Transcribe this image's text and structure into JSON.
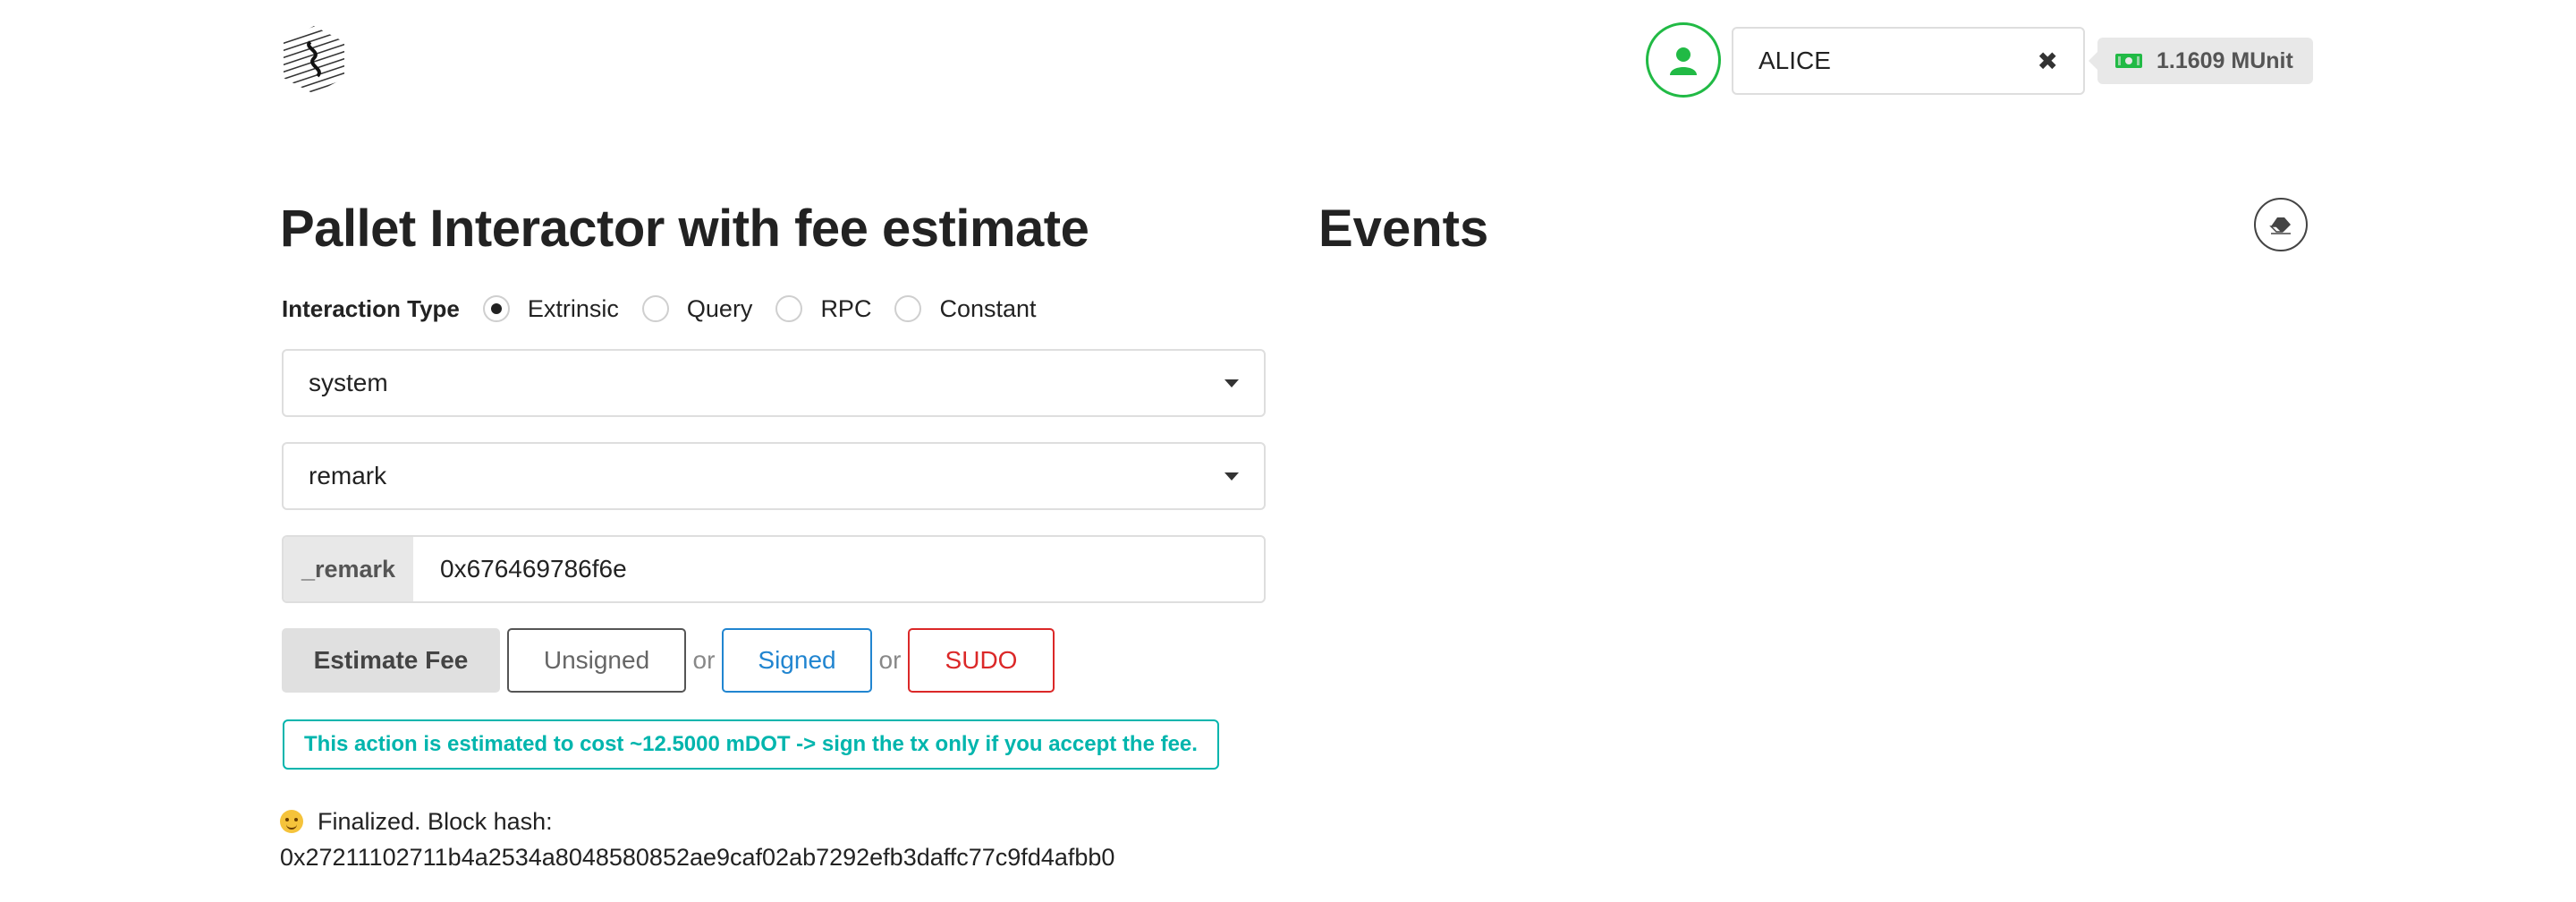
{
  "header": {
    "logo_icon": "substrate-logo-icon",
    "avatar_icon": "user-icon",
    "account": {
      "selected": "ALICE",
      "clear_icon": "close-icon"
    },
    "balance": {
      "icon": "money-bill-icon",
      "text": "1.1609 MUnit"
    }
  },
  "interactor": {
    "title": "Pallet Interactor with fee estimate",
    "interaction_type": {
      "label": "Interaction Type",
      "options": [
        {
          "label": "Extrinsic",
          "checked": true
        },
        {
          "label": "Query",
          "checked": false
        },
        {
          "label": "RPC",
          "checked": false
        },
        {
          "label": "Constant",
          "checked": false
        }
      ]
    },
    "pallet_select": "system",
    "callable_select": "remark",
    "params": [
      {
        "label": "_remark",
        "value": "0x676469786f6e"
      }
    ],
    "buttons": {
      "estimate": "Estimate Fee",
      "unsigned": "Unsigned",
      "signed": "Signed",
      "sudo": "SUDO",
      "or": "or"
    },
    "fee_message": "This action is estimated to cost ~12.5000 mDOT -> sign the tx only if you accept the fee.",
    "status": {
      "emoji_icon": "wink-emoji-icon",
      "line1": "Finalized. Block hash:",
      "line2": "0x27211102711b4a2534a8048580852ae9caf02ab7292efb3daffc77c9fd4afbb0"
    }
  },
  "events": {
    "title": "Events",
    "clear_icon": "eraser-icon"
  },
  "colors": {
    "green": "#21ba45",
    "teal": "#00b5ad",
    "blue": "#2185d0",
    "red": "#db2828"
  }
}
